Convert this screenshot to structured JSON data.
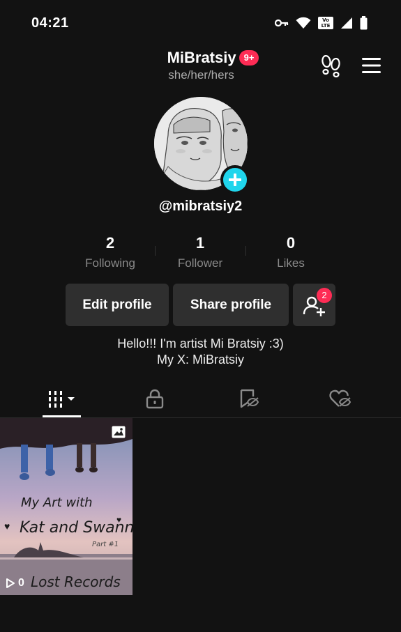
{
  "status_bar": {
    "time": "04:21",
    "icons": [
      "vpn-key-icon",
      "wifi-icon",
      "volte-icon",
      "signal-icon",
      "battery-icon"
    ],
    "volte_line1": "Vo",
    "volte_line2": "LTE"
  },
  "header": {
    "username": "MiBratsiy",
    "notification_badge": "9+",
    "pronouns": "she/her/hers",
    "icons": [
      "footprints-icon",
      "menu-icon"
    ]
  },
  "profile": {
    "handle": "@mibratsiy2",
    "avatar_icon": "avatar-add-plus-icon"
  },
  "stats": [
    {
      "value": "2",
      "label": "Following"
    },
    {
      "value": "1",
      "label": "Follower"
    },
    {
      "value": "0",
      "label": "Likes"
    }
  ],
  "actions": {
    "edit_label": "Edit profile",
    "share_label": "Share profile",
    "add_friends_badge": "2"
  },
  "bio": {
    "line1": "Hello!!! I'm artist Mi Bratsiy :3)",
    "line2": "My X: MiBratsiy"
  },
  "tabs": [
    {
      "name": "videos-grid-icon",
      "selected": true
    },
    {
      "name": "lock-icon",
      "selected": false
    },
    {
      "name": "saved-hidden-icon",
      "selected": false
    },
    {
      "name": "liked-hidden-icon",
      "selected": false
    }
  ],
  "posts": [
    {
      "caption_line1": "My Art with",
      "caption_line2": "Kat and Swann",
      "caption_part": "Part #1",
      "caption_line3": "Lost   Records",
      "views": "0",
      "type_icon": "photo-icon"
    }
  ],
  "colors": {
    "background": "#121212",
    "accent_red": "#fe2c55",
    "accent_cyan": "#20d5ec",
    "button_bg": "#2f2f2f"
  }
}
